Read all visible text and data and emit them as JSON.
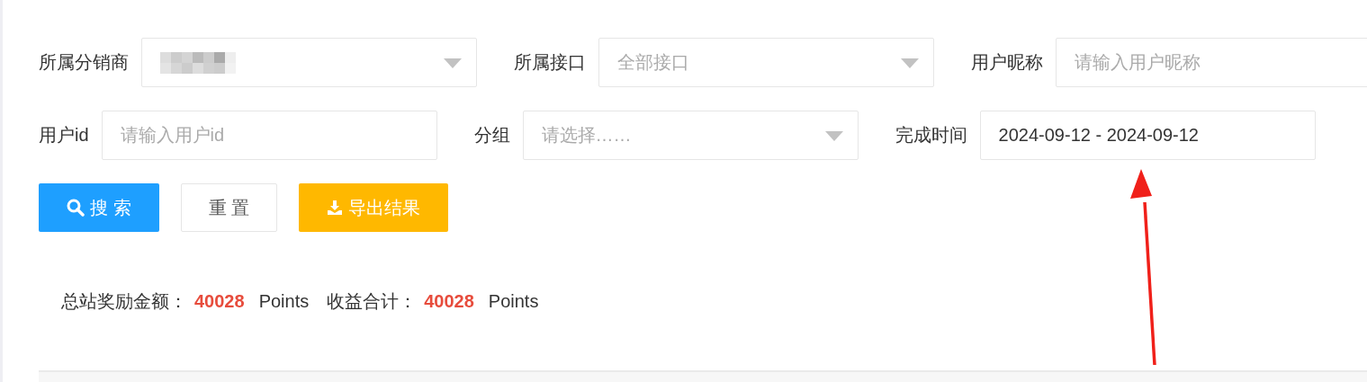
{
  "filters": [
    [
      {
        "label": "所属分销商",
        "kind": "select",
        "value_redacted": true
      },
      {
        "label": "所属接口",
        "kind": "select",
        "placeholder": "全部接口"
      },
      {
        "label": "用户昵称",
        "kind": "input",
        "placeholder": "请输入用户昵称"
      }
    ],
    [
      {
        "label": "用户id",
        "kind": "input",
        "placeholder": "请输入用户id"
      },
      {
        "label": "分组",
        "kind": "select",
        "placeholder": "请选择……"
      },
      {
        "label": "完成时间",
        "kind": "input",
        "value": "2024-09-12 - 2024-09-12"
      }
    ]
  ],
  "buttons": [
    {
      "label": "搜 索",
      "kind": "primary"
    },
    {
      "label": "重 置",
      "kind": "default"
    },
    {
      "label": "导出结果",
      "kind": "warning"
    }
  ],
  "summary": [
    {
      "label": "总站奖励金额：",
      "amount": "40028",
      "unit": "Points"
    },
    {
      "label": "收益合计：",
      "amount": "40028",
      "unit": "Points"
    }
  ],
  "annotation": {
    "kind": "arrow"
  }
}
